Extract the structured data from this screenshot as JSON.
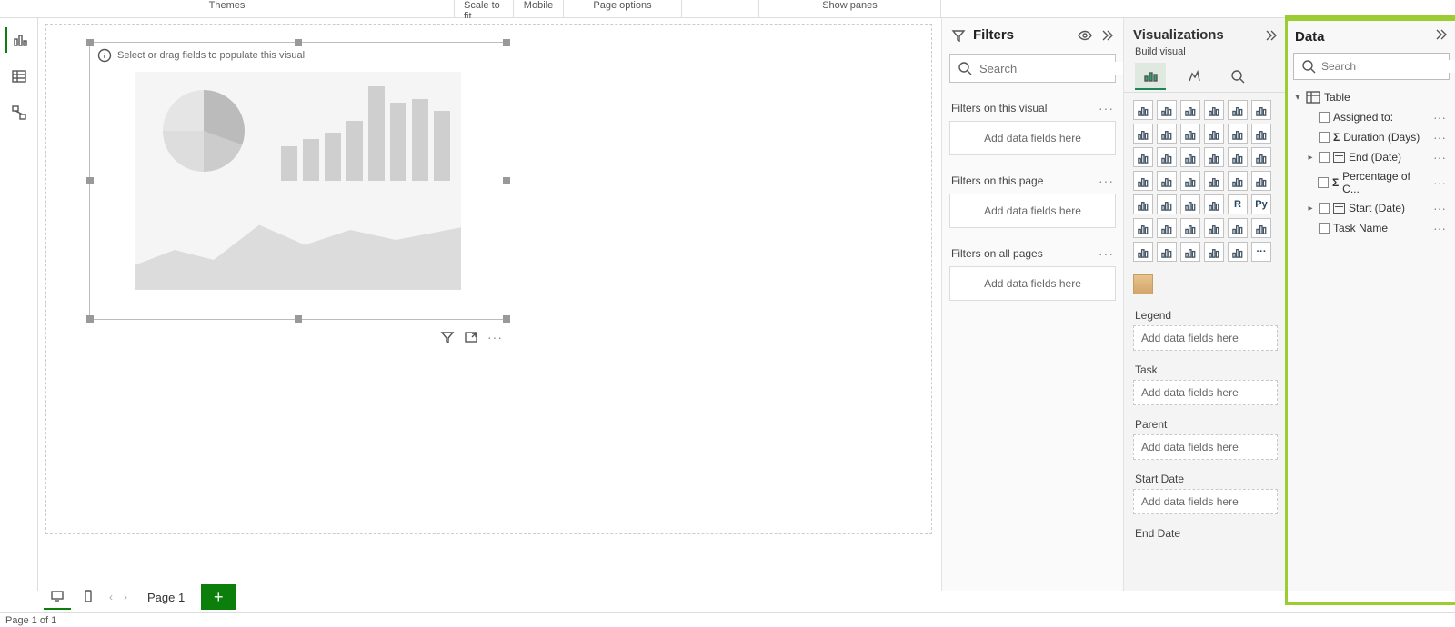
{
  "ribbon": {
    "themes": "Themes",
    "scale": "Scale to fit",
    "mobile": "Mobile",
    "page_options": "Page options",
    "show_panes": "Show panes"
  },
  "canvas": {
    "placeholder_hint": "Select or drag fields to populate this visual"
  },
  "filters": {
    "title": "Filters",
    "search_placeholder": "Search",
    "sections": {
      "visual": "Filters on this visual",
      "page": "Filters on this page",
      "all": "Filters on all pages"
    },
    "add_hint": "Add data fields here"
  },
  "viz": {
    "title": "Visualizations",
    "build_label": "Build visual",
    "icons": [
      "stacked-bar",
      "clustered-bar",
      "stacked-column",
      "clustered-column",
      "stacked-bar-100",
      "stacked-column-100",
      "line",
      "area",
      "stacked-area",
      "line-clustered",
      "line-stacked",
      "ribbon",
      "waterfall",
      "funnel",
      "scatter",
      "pie",
      "donut",
      "treemap",
      "map",
      "filled-map",
      "azure-map",
      "gauge",
      "card",
      "multi-row",
      "kpi",
      "slicer",
      "table",
      "matrix",
      "r-visual",
      "py-visual",
      "key-influencers",
      "decomposition",
      "qna",
      "narrative",
      "goals",
      "paginated",
      "arcgis",
      "powerapps",
      "powerautomate",
      "custom-1",
      "custom-2",
      "more"
    ],
    "field_wells": [
      {
        "label": "Legend",
        "hint": "Add data fields here",
        "arrow": false
      },
      {
        "label": "Task",
        "hint": "Add data fields here",
        "arrow": true
      },
      {
        "label": "Parent",
        "hint": "Add data fields here",
        "arrow": false
      },
      {
        "label": "Start Date",
        "hint": "Add data fields here",
        "arrow": true
      },
      {
        "label": "End Date",
        "hint": "",
        "arrow": false
      }
    ]
  },
  "data": {
    "title": "Data",
    "search_placeholder": "Search",
    "table_name": "Table",
    "fields": [
      {
        "name": "Assigned to:",
        "sigma": false,
        "date": false,
        "expandable": false
      },
      {
        "name": "Duration (Days)",
        "sigma": true,
        "date": false,
        "expandable": false
      },
      {
        "name": "End (Date)",
        "sigma": false,
        "date": true,
        "expandable": true
      },
      {
        "name": "Percentage of C...",
        "sigma": true,
        "date": false,
        "expandable": false
      },
      {
        "name": "Start (Date)",
        "sigma": false,
        "date": true,
        "expandable": true
      },
      {
        "name": "Task Name",
        "sigma": false,
        "date": false,
        "expandable": false
      }
    ]
  },
  "tabs": {
    "page1": "Page 1",
    "page_status": "Page 1 of 1"
  }
}
